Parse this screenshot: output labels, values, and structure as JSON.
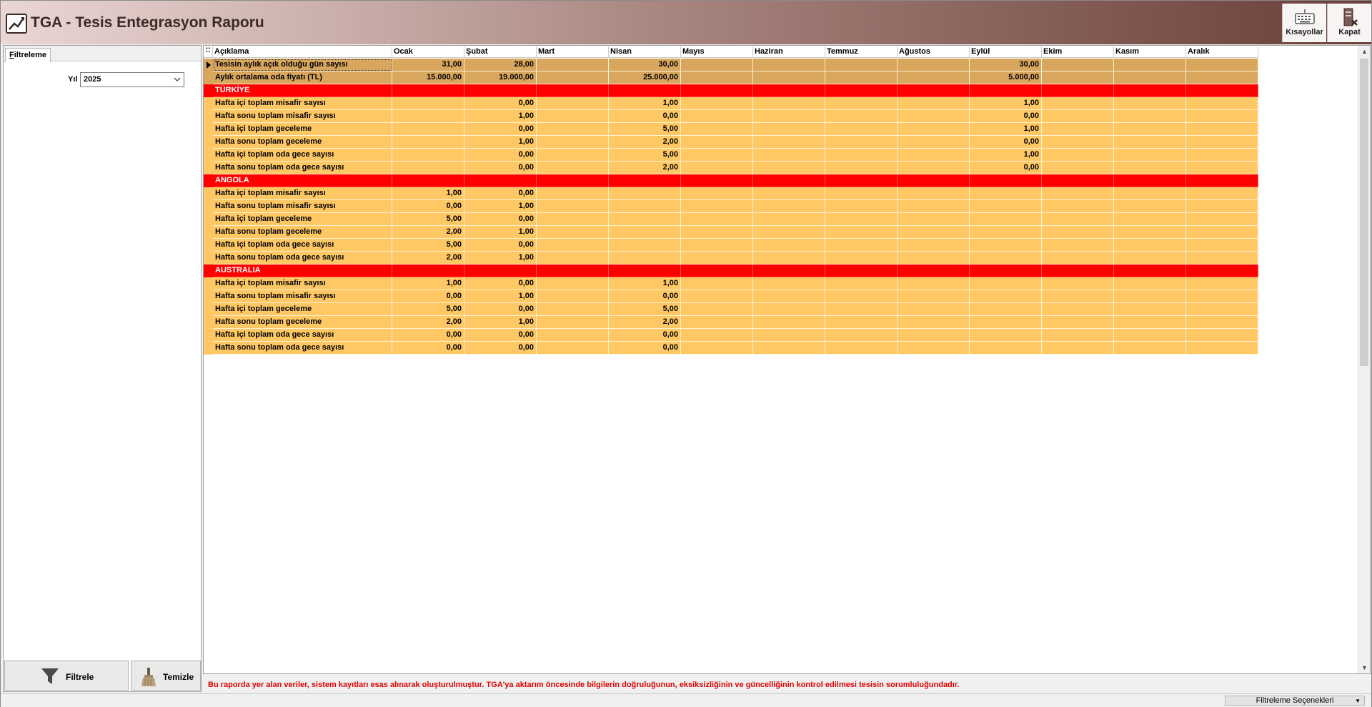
{
  "window": {
    "title": "TGA - Tesis Entegrasyon Raporu"
  },
  "toolbar": {
    "shortcuts_label": "Kısayollar",
    "close_label": "Kapat"
  },
  "filter_panel": {
    "tab_label_first": "F",
    "tab_label_rest": "iltreleme",
    "year_label": "Yıl",
    "year_value": "2025",
    "filter_button": "Filtrele",
    "clear_button": "Temizle"
  },
  "grid": {
    "columns": [
      "Açıklama",
      "Ocak",
      "Şubat",
      "Mart",
      "Nisan",
      "Mayıs",
      "Haziran",
      "Temmuz",
      "Ağustos",
      "Eylül",
      "Ekim",
      "Kasım",
      "Aralık"
    ],
    "rows": [
      {
        "type": "summary",
        "cells": [
          "Tesisin aylık açık olduğu gün sayısı",
          "31,00",
          "28,00",
          "",
          "30,00",
          "",
          "",
          "",
          "",
          "30,00",
          "",
          "",
          ""
        ]
      },
      {
        "type": "summary",
        "cells": [
          "Aylık ortalama oda fiyatı (TL)",
          "15.000,00",
          "19.000,00",
          "",
          "25.000,00",
          "",
          "",
          "",
          "",
          "5.000,00",
          "",
          "",
          ""
        ]
      },
      {
        "type": "group",
        "cells": [
          "TÜRKİYE",
          "",
          "",
          "",
          "",
          "",
          "",
          "",
          "",
          "",
          "",
          "",
          ""
        ]
      },
      {
        "type": "data",
        "cells": [
          "Hafta içi toplam misafir sayısı",
          "",
          "0,00",
          "",
          "1,00",
          "",
          "",
          "",
          "",
          "1,00",
          "",
          "",
          ""
        ]
      },
      {
        "type": "data",
        "cells": [
          "Hafta sonu toplam misafir sayısı",
          "",
          "1,00",
          "",
          "0,00",
          "",
          "",
          "",
          "",
          "0,00",
          "",
          "",
          ""
        ]
      },
      {
        "type": "data",
        "cells": [
          "Hafta içi toplam geceleme",
          "",
          "0,00",
          "",
          "5,00",
          "",
          "",
          "",
          "",
          "1,00",
          "",
          "",
          ""
        ]
      },
      {
        "type": "data",
        "cells": [
          "Hafta sonu toplam geceleme",
          "",
          "1,00",
          "",
          "2,00",
          "",
          "",
          "",
          "",
          "0,00",
          "",
          "",
          ""
        ]
      },
      {
        "type": "data",
        "cells": [
          "Hafta içi toplam oda gece sayısı",
          "",
          "0,00",
          "",
          "5,00",
          "",
          "",
          "",
          "",
          "1,00",
          "",
          "",
          ""
        ]
      },
      {
        "type": "data",
        "cells": [
          "Hafta sonu toplam oda gece sayısı",
          "",
          "0,00",
          "",
          "2,00",
          "",
          "",
          "",
          "",
          "0,00",
          "",
          "",
          ""
        ]
      },
      {
        "type": "group",
        "cells": [
          "ANGOLA",
          "",
          "",
          "",
          "",
          "",
          "",
          "",
          "",
          "",
          "",
          "",
          ""
        ]
      },
      {
        "type": "data",
        "cells": [
          "Hafta içi toplam misafir sayısı",
          "1,00",
          "0,00",
          "",
          "",
          "",
          "",
          "",
          "",
          "",
          "",
          "",
          ""
        ]
      },
      {
        "type": "data",
        "cells": [
          "Hafta sonu toplam misafir sayısı",
          "0,00",
          "1,00",
          "",
          "",
          "",
          "",
          "",
          "",
          "",
          "",
          "",
          ""
        ]
      },
      {
        "type": "data",
        "cells": [
          "Hafta içi toplam geceleme",
          "5,00",
          "0,00",
          "",
          "",
          "",
          "",
          "",
          "",
          "",
          "",
          "",
          ""
        ]
      },
      {
        "type": "data",
        "cells": [
          "Hafta sonu toplam geceleme",
          "2,00",
          "1,00",
          "",
          "",
          "",
          "",
          "",
          "",
          "",
          "",
          "",
          ""
        ]
      },
      {
        "type": "data",
        "cells": [
          "Hafta içi toplam oda gece sayısı",
          "5,00",
          "0,00",
          "",
          "",
          "",
          "",
          "",
          "",
          "",
          "",
          "",
          ""
        ]
      },
      {
        "type": "data",
        "cells": [
          "Hafta sonu toplam oda gece sayısı",
          "2,00",
          "1,00",
          "",
          "",
          "",
          "",
          "",
          "",
          "",
          "",
          "",
          ""
        ]
      },
      {
        "type": "group",
        "cells": [
          "AUSTRALIA",
          "",
          "",
          "",
          "",
          "",
          "",
          "",
          "",
          "",
          "",
          "",
          ""
        ]
      },
      {
        "type": "data",
        "cells": [
          "Hafta içi toplam misafir sayısı",
          "1,00",
          "0,00",
          "",
          "1,00",
          "",
          "",
          "",
          "",
          "",
          "",
          "",
          ""
        ]
      },
      {
        "type": "data",
        "cells": [
          "Hafta sonu toplam misafir sayısı",
          "0,00",
          "1,00",
          "",
          "0,00",
          "",
          "",
          "",
          "",
          "",
          "",
          "",
          ""
        ]
      },
      {
        "type": "data",
        "cells": [
          "Hafta içi toplam geceleme",
          "5,00",
          "0,00",
          "",
          "5,00",
          "",
          "",
          "",
          "",
          "",
          "",
          "",
          ""
        ]
      },
      {
        "type": "data",
        "cells": [
          "Hafta sonu toplam geceleme",
          "2,00",
          "1,00",
          "",
          "2,00",
          "",
          "",
          "",
          "",
          "",
          "",
          "",
          ""
        ]
      },
      {
        "type": "data",
        "cells": [
          "Hafta içi toplam oda gece sayısı",
          "0,00",
          "0,00",
          "",
          "0,00",
          "",
          "",
          "",
          "",
          "",
          "",
          "",
          ""
        ]
      },
      {
        "type": "data",
        "cells": [
          "Hafta sonu toplam oda gece sayısı",
          "0,00",
          "0,00",
          "",
          "0,00",
          "",
          "",
          "",
          "",
          "",
          "",
          "",
          ""
        ]
      }
    ]
  },
  "footer": {
    "disclaimer": "Bu raporda yer alan veriler, sistem kayıtları esas alınarak oluşturulmuştur. TGA'ya aktarım öncesinde bilgilerin doğruluğunun, eksiksizliğinin ve güncelliğinin kontrol edilmesi tesisin sorumluluğundadır.",
    "filter_options_label": "Filtreleme Seçenekleri"
  },
  "colors": {
    "summary_row": "#d9a65e",
    "group_row": "#ff0000",
    "data_row": "#ffc864",
    "disclaimer": "#e00000"
  }
}
